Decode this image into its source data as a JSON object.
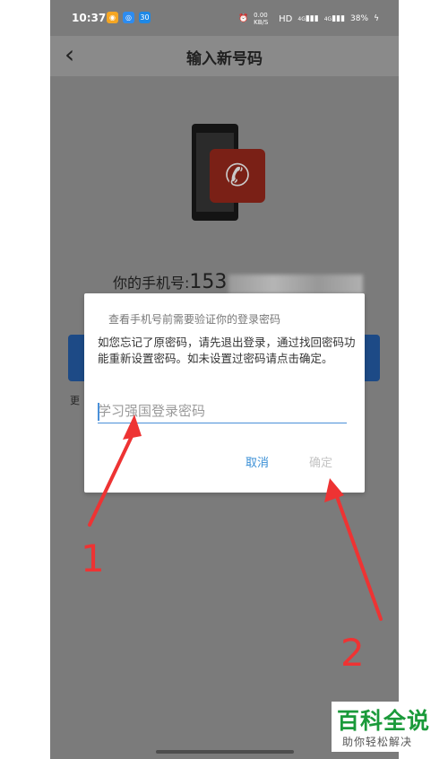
{
  "status_bar": {
    "time": "10:37",
    "apps": [
      {
        "name": "weibo-icon",
        "color": "#f5a623",
        "glyph": "◉"
      },
      {
        "name": "app-icon",
        "color": "#2d8cf0",
        "glyph": "◎"
      },
      {
        "name": "badge-icon",
        "color": "#1e88e5",
        "glyph": "30"
      }
    ],
    "speed": "0.00 KB/S",
    "hd": "HD",
    "sig1": "4G",
    "sig2": "4G",
    "battery": "38%"
  },
  "header": {
    "back_glyph": "‹",
    "title": "输入新号码"
  },
  "main": {
    "phone_label": "你的手机号:",
    "phone_digits": "153"
  },
  "dialog": {
    "title": "查看手机号前需要验证你的登录密码",
    "message": "如您忘记了原密码，请先退出登录，通过找回密码功能重新设置密码。如未设置过密码请点击确定。",
    "placeholder": "学习强国登录密码",
    "cancel": "取消",
    "confirm": "确定"
  },
  "annotations": {
    "num1": "1",
    "num2": "2",
    "color": "#ee3333"
  },
  "watermark": {
    "main": "百科全说",
    "sub": "助你轻松解决"
  }
}
